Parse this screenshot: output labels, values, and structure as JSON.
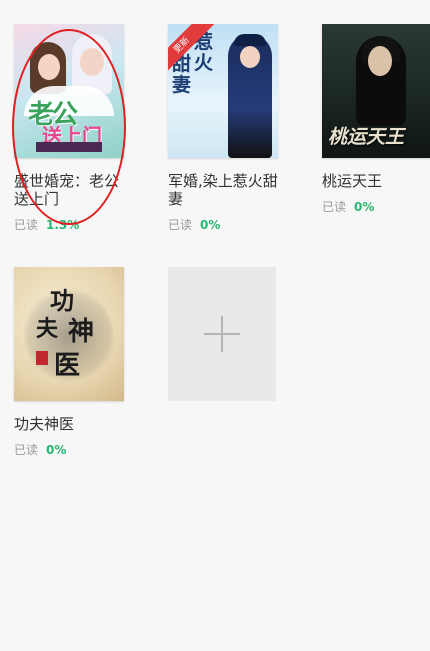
{
  "books": [
    {
      "title": "盛世婚宠：老公送上门",
      "progress_label": "已读",
      "progress_value": "1.3%",
      "cover": {
        "line1": "老公",
        "line2": "送上门",
        "strip_text": ""
      }
    },
    {
      "title": "军婚,染上惹火甜妻",
      "progress_label": "已读",
      "progress_value": "0%",
      "cover": {
        "ribbon": "更新",
        "title_col1": "惹火",
        "title_col2": "甜妻"
      }
    },
    {
      "title": "桃运天王",
      "progress_label": "已读",
      "progress_value": "0%",
      "cover": {
        "title": "桃运天王",
        "author": ""
      }
    },
    {
      "title": "功夫神医",
      "progress_label": "已读",
      "progress_value": "0%",
      "cover": {
        "c1": "功",
        "c2": "夫",
        "c3": "神",
        "c4": "医"
      }
    }
  ],
  "add_tile": {
    "icon": "plus-icon"
  },
  "colors": {
    "background": "#f7f7f7",
    "progress_percent": "#2bb673",
    "annotation": "#e02020"
  }
}
